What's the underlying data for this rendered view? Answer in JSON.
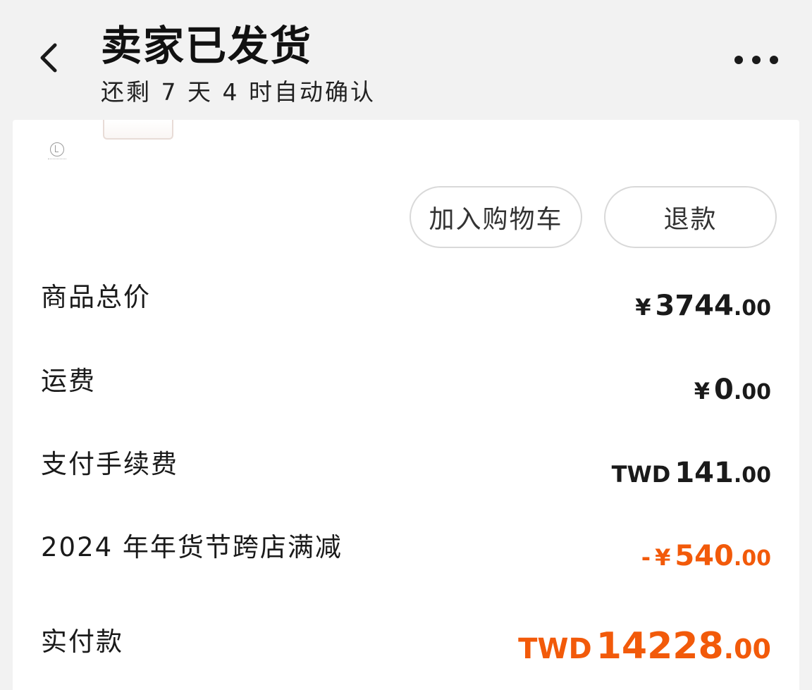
{
  "header": {
    "title": "卖家已发货",
    "subtitle": "还剩 7 天 4 时自动确认"
  },
  "actions": {
    "add_to_cart": "加入购物车",
    "refund": "退款"
  },
  "summary": {
    "items_total": {
      "label": "商品总价",
      "currency": "¥",
      "integer": "3744",
      "decimal": ".00"
    },
    "shipping": {
      "label": "运费",
      "currency": "¥",
      "integer": "0",
      "decimal": ".00"
    },
    "payment_fee": {
      "label": "支付手续费",
      "currency": "TWD",
      "integer": "141",
      "decimal": ".00"
    },
    "discount": {
      "label": "2024 年年货节跨店满减",
      "sign": "-",
      "currency": "¥",
      "integer": "540",
      "decimal": ".00"
    },
    "paid": {
      "label": "实付款",
      "currency": "TWD",
      "integer": "14228",
      "decimal": ".00"
    }
  },
  "colors": {
    "accent": "#f25a0a",
    "background": "#f2f2f2",
    "card": "#ffffff"
  },
  "icons": {
    "back": "chevron-left-icon",
    "more": "more-dots-icon",
    "shop": "shop-logo-icon"
  }
}
